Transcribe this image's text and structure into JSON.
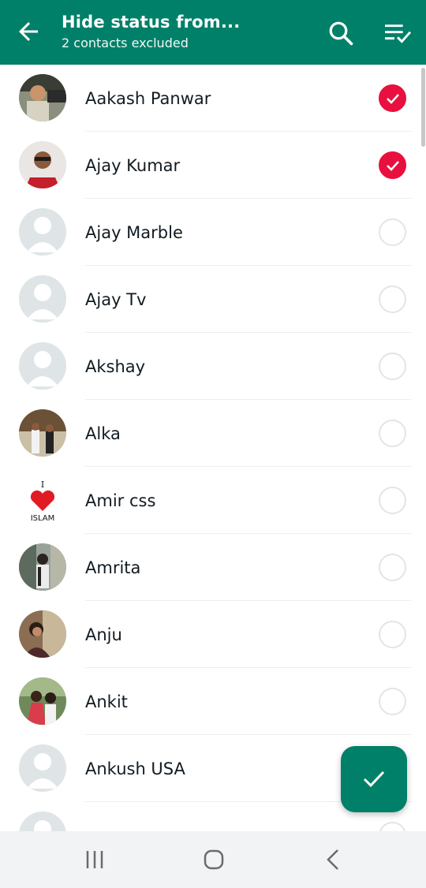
{
  "header": {
    "title": "Hide status from...",
    "subtitle": "2 contacts excluded",
    "icons": {
      "back": "arrow-left-icon",
      "search": "search-icon",
      "select_all": "select-all-icon"
    }
  },
  "contacts": [
    {
      "name": "Aakash Panwar",
      "selected": true
    },
    {
      "name": "Ajay Kumar",
      "selected": true
    },
    {
      "name": "Ajay Marble",
      "selected": false
    },
    {
      "name": "Ajay Tv",
      "selected": false
    },
    {
      "name": "Akshay",
      "selected": false
    },
    {
      "name": "Alka",
      "selected": false
    },
    {
      "name": "Amir css",
      "selected": false
    },
    {
      "name": "Amrita",
      "selected": false
    },
    {
      "name": "Anju",
      "selected": false
    },
    {
      "name": "Ankit",
      "selected": false
    },
    {
      "name": "Ankush USA",
      "selected": false
    }
  ],
  "avatar_badge": {
    "line1": "I",
    "line2": "ISLAM"
  },
  "fab": {
    "icon": "check-icon"
  },
  "colors": {
    "primary": "#008069",
    "selected": "#e8103f",
    "divider": "#eceff1"
  }
}
